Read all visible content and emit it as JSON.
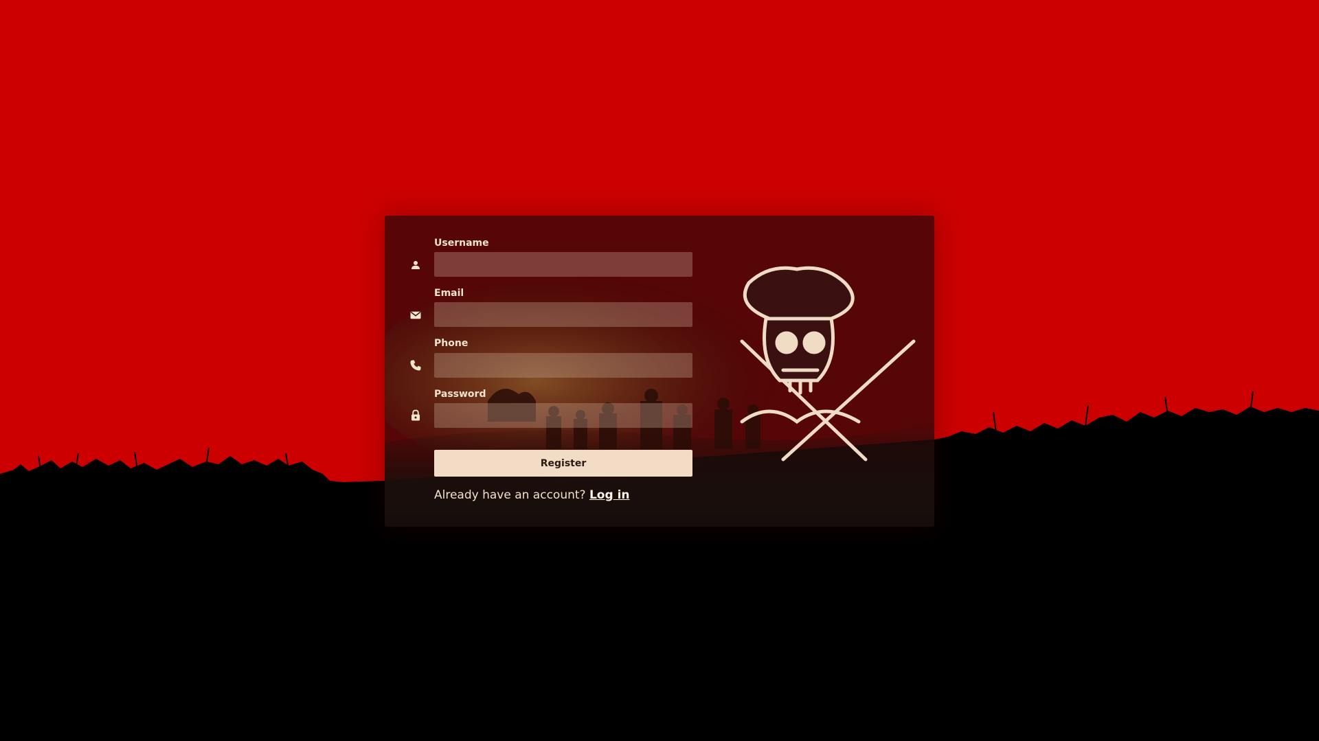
{
  "form": {
    "fields": [
      {
        "label": "Username",
        "value": "",
        "placeholder": "",
        "icon": "person-icon"
      },
      {
        "label": "Email",
        "value": "",
        "placeholder": "",
        "icon": "mail-icon"
      },
      {
        "label": "Phone",
        "value": "",
        "placeholder": "",
        "icon": "phone-icon"
      },
      {
        "label": "Password",
        "value": "",
        "placeholder": "",
        "icon": "lock-icon"
      }
    ],
    "register_label": "Register",
    "login_prompt": "Already have an account?",
    "login_link": "Log in"
  },
  "colors": {
    "sky": "#cc0000",
    "ground": "#000000",
    "panel": "#280808",
    "button": "#f2dcc6",
    "text": "#f3e4cf"
  }
}
